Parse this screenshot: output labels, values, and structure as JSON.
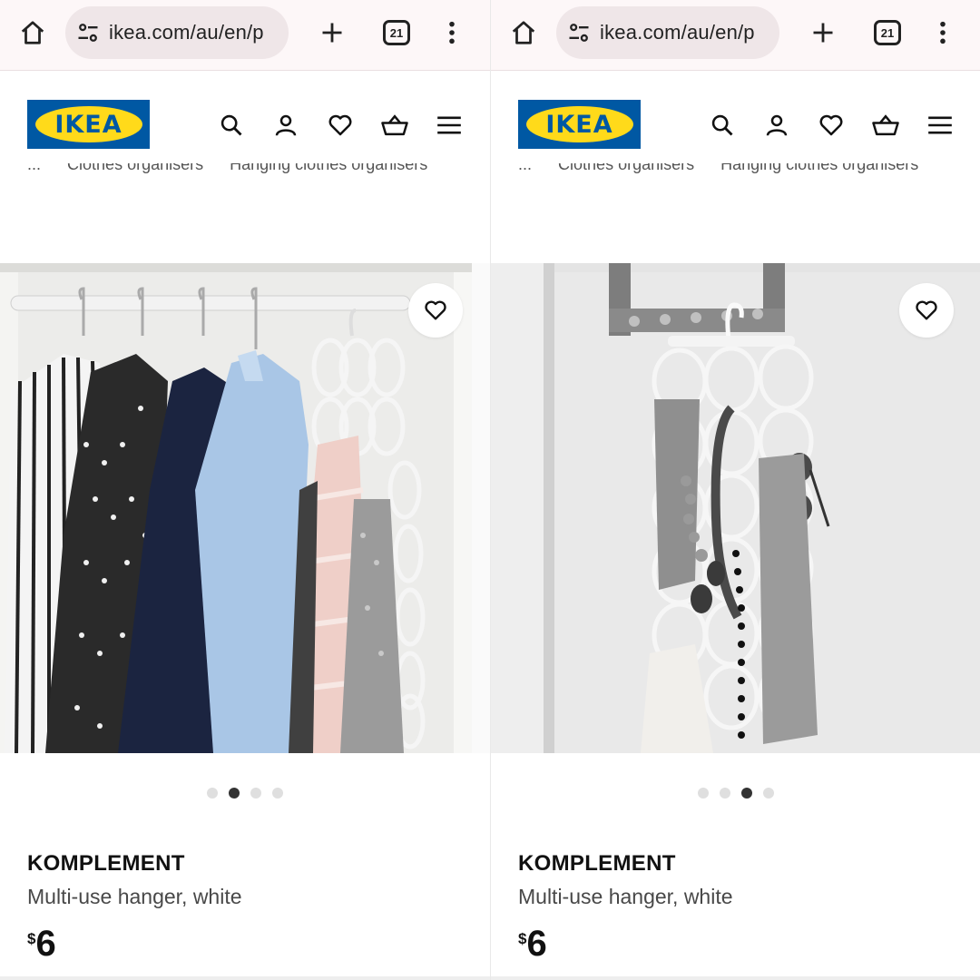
{
  "panes": [
    {
      "browser": {
        "url": "ikea.com/au/en/p",
        "tab_count": "21"
      },
      "header": {
        "logo": "IKEA"
      },
      "breadcrumb": [
        "...",
        "Clothes organisers",
        "Hanging clothes organisers"
      ],
      "product": {
        "name": "KOMPLEMENT",
        "description": "Multi-use hanger, white",
        "currency": "$",
        "price": "6",
        "active_image_index": 1,
        "image_count": 4
      }
    },
    {
      "browser": {
        "url": "ikea.com/au/en/p",
        "tab_count": "21"
      },
      "header": {
        "logo": "IKEA"
      },
      "breadcrumb": [
        "...",
        "Clothes organisers",
        "Hanging clothes organisers"
      ],
      "product": {
        "name": "KOMPLEMENT",
        "description": "Multi-use hanger, white",
        "currency": "$",
        "price": "6",
        "active_image_index": 2,
        "image_count": 4
      }
    }
  ],
  "colors": {
    "ikea_blue": "#0058a3",
    "ikea_yellow": "#ffda1a",
    "chrome_bg": "#fdf7f8",
    "url_pill": "#efe6e8"
  },
  "icons": [
    "home-icon",
    "site-settings-icon",
    "new-tab-icon",
    "tab-switcher-icon",
    "more-menu-icon",
    "search-icon",
    "account-icon",
    "wishlist-icon",
    "cart-icon",
    "menu-icon",
    "favourite-heart-icon"
  ]
}
